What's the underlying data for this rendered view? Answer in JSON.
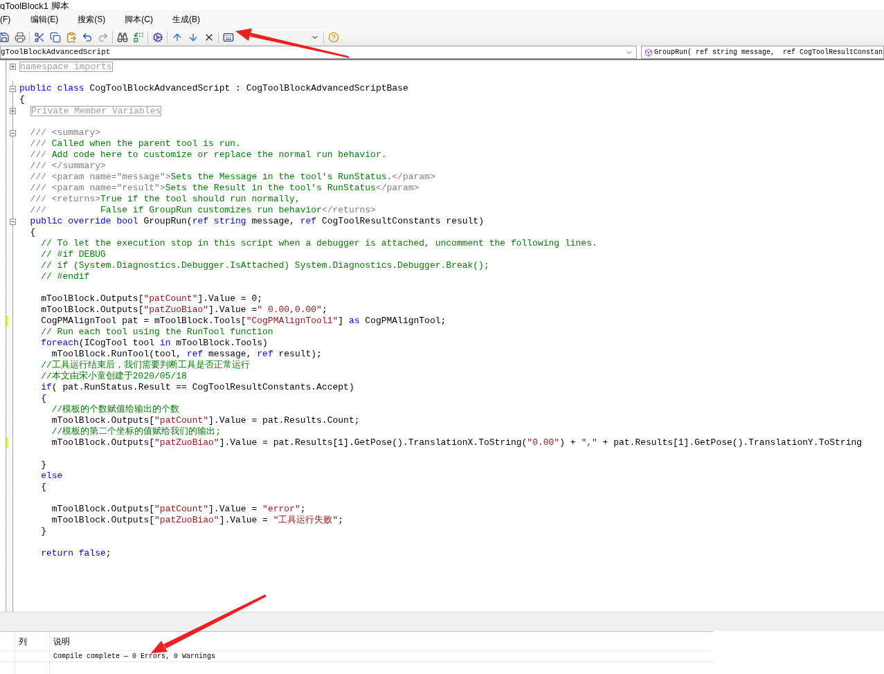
{
  "window": {
    "title": "gToolBlock1 脚本"
  },
  "menu": [
    {
      "label": "(F)"
    },
    {
      "label": "编辑(E)"
    },
    {
      "label": "搜索(S)"
    },
    {
      "label": "脚本(C)"
    },
    {
      "label": "生成(B)"
    }
  ],
  "class_selector": {
    "value": "gToolBlockAdvancedScript"
  },
  "member_selector": {
    "value": "GroupRun( ref string message,  ref CogToolResultConstan"
  },
  "editor": {
    "lines": [
      {
        "kind": "region",
        "changed": false,
        "collapsed": true,
        "text": "namespace imports"
      },
      {
        "kind": "blank",
        "changed": false
      },
      {
        "kind": "code",
        "changed": false,
        "collapsed": false,
        "tokens": [
          {
            "kind": "kw",
            "text": "public class "
          },
          {
            "kind": "plain",
            "text": "CogToolBlockAdvancedScript : CogToolBlockAdvancedScriptBase"
          }
        ]
      },
      {
        "kind": "code",
        "changed": false,
        "tokens": [
          {
            "kind": "plain",
            "text": "{"
          }
        ]
      },
      {
        "kind": "subregion",
        "changed": false,
        "collapsed": true,
        "text": "Private Member Variables"
      },
      {
        "kind": "blank",
        "changed": false
      },
      {
        "kind": "code",
        "changed": false,
        "collapsed": false,
        "tokens": [
          {
            "kind": "doc",
            "text": "  /// <summary>"
          }
        ]
      },
      {
        "kind": "code",
        "changed": false,
        "tokens": [
          {
            "kind": "doc",
            "text": "  /// "
          },
          {
            "kind": "comment",
            "text": "Called when the parent tool is run."
          }
        ]
      },
      {
        "kind": "code",
        "changed": false,
        "tokens": [
          {
            "kind": "doc",
            "text": "  /// "
          },
          {
            "kind": "comment",
            "text": "Add code here to customize or replace the normal run behavior."
          }
        ]
      },
      {
        "kind": "code",
        "changed": false,
        "tokens": [
          {
            "kind": "doc",
            "text": "  /// </summary>"
          }
        ]
      },
      {
        "kind": "code",
        "changed": false,
        "tokens": [
          {
            "kind": "doc",
            "text": "  /// <param name=\"message\">"
          },
          {
            "kind": "comment",
            "text": "Sets the Message in the tool's RunStatus."
          },
          {
            "kind": "doc",
            "text": "</param>"
          }
        ]
      },
      {
        "kind": "code",
        "changed": false,
        "tokens": [
          {
            "kind": "doc",
            "text": "  /// <param name=\"result\">"
          },
          {
            "kind": "comment",
            "text": "Sets the Result in the tool's RunStatus"
          },
          {
            "kind": "doc",
            "text": "</param>"
          }
        ]
      },
      {
        "kind": "code",
        "changed": false,
        "tokens": [
          {
            "kind": "doc",
            "text": "  /// <returns>"
          },
          {
            "kind": "comment",
            "text": "True if the tool should run normally,"
          }
        ]
      },
      {
        "kind": "code",
        "changed": false,
        "tokens": [
          {
            "kind": "doc",
            "text": "  ///          "
          },
          {
            "kind": "comment",
            "text": "False if GroupRun customizes run behavior"
          },
          {
            "kind": "doc",
            "text": "</returns>"
          }
        ]
      },
      {
        "kind": "code",
        "changed": false,
        "collapsed": false,
        "tokens": [
          {
            "kind": "kw",
            "text": "  public override bool "
          },
          {
            "kind": "plain",
            "text": "GroupRun("
          },
          {
            "kind": "kw",
            "text": "ref string "
          },
          {
            "kind": "plain",
            "text": "message, "
          },
          {
            "kind": "kw",
            "text": "ref "
          },
          {
            "kind": "plain",
            "text": "CogToolResultConstants result)"
          }
        ]
      },
      {
        "kind": "code",
        "changed": false,
        "tokens": [
          {
            "kind": "plain",
            "text": "  {"
          }
        ]
      },
      {
        "kind": "code",
        "changed": false,
        "tokens": [
          {
            "kind": "comment",
            "text": "    // To let the execution stop in this script when a debugger is attached, uncomment the following lines."
          }
        ]
      },
      {
        "kind": "code",
        "changed": false,
        "tokens": [
          {
            "kind": "comment",
            "text": "    // #if DEBUG"
          }
        ]
      },
      {
        "kind": "code",
        "changed": false,
        "tokens": [
          {
            "kind": "comment",
            "text": "    // if (System.Diagnostics.Debugger.IsAttached) System.Diagnostics.Debugger.Break();"
          }
        ]
      },
      {
        "kind": "code",
        "changed": false,
        "tokens": [
          {
            "kind": "comment",
            "text": "    // #endif"
          }
        ]
      },
      {
        "kind": "blank",
        "changed": false
      },
      {
        "kind": "code",
        "changed": false,
        "tokens": [
          {
            "kind": "plain",
            "text": "    mToolBlock.Outputs["
          },
          {
            "kind": "str",
            "text": "\"patCount\""
          },
          {
            "kind": "plain",
            "text": "].Value = 0;"
          }
        ]
      },
      {
        "kind": "code",
        "changed": false,
        "tokens": [
          {
            "kind": "plain",
            "text": "    mToolBlock.Outputs["
          },
          {
            "kind": "str",
            "text": "\"patZuoBiao\""
          },
          {
            "kind": "plain",
            "text": "].Value ="
          },
          {
            "kind": "str",
            "text": "\" 0.00,0.00\""
          },
          {
            "kind": "plain",
            "text": ";"
          }
        ]
      },
      {
        "kind": "code",
        "changed": true,
        "tokens": [
          {
            "kind": "plain",
            "text": "    CogPMAlignTool pat = mToolBlock.Tools["
          },
          {
            "kind": "str",
            "text": "\"CogPMAlignTool1\""
          },
          {
            "kind": "plain",
            "text": "] "
          },
          {
            "kind": "kw",
            "text": "as "
          },
          {
            "kind": "plain",
            "text": "CogPMAlignTool;"
          }
        ]
      },
      {
        "kind": "code",
        "changed": false,
        "tokens": [
          {
            "kind": "comment",
            "text": "    // Run each tool using the RunTool function"
          }
        ]
      },
      {
        "kind": "code",
        "changed": false,
        "tokens": [
          {
            "kind": "kw",
            "text": "    foreach"
          },
          {
            "kind": "plain",
            "text": "(ICogTool tool "
          },
          {
            "kind": "kw",
            "text": "in "
          },
          {
            "kind": "plain",
            "text": "mToolBlock.Tools)"
          }
        ]
      },
      {
        "kind": "code",
        "changed": false,
        "tokens": [
          {
            "kind": "plain",
            "text": "      mToolBlock.RunTool(tool, "
          },
          {
            "kind": "kw",
            "text": "ref "
          },
          {
            "kind": "plain",
            "text": "message, "
          },
          {
            "kind": "kw",
            "text": "ref "
          },
          {
            "kind": "plain",
            "text": "result);"
          }
        ]
      },
      {
        "kind": "code",
        "changed": false,
        "tokens": [
          {
            "kind": "comment",
            "text": "    //工具运行结束后，我们需要判断工具是否正常运行"
          }
        ]
      },
      {
        "kind": "code",
        "changed": false,
        "tokens": [
          {
            "kind": "comment",
            "text": "    //本文由宋小童创建于2020/05/18"
          }
        ]
      },
      {
        "kind": "code",
        "changed": false,
        "tokens": [
          {
            "kind": "kw",
            "text": "    if"
          },
          {
            "kind": "plain",
            "text": "( pat.RunStatus.Result == CogToolResultConstants.Accept)"
          }
        ]
      },
      {
        "kind": "code",
        "changed": false,
        "tokens": [
          {
            "kind": "plain",
            "text": "    {"
          }
        ]
      },
      {
        "kind": "code",
        "changed": false,
        "tokens": [
          {
            "kind": "comment",
            "text": "      //模板的个数赋值给输出的个数"
          }
        ]
      },
      {
        "kind": "code",
        "changed": false,
        "tokens": [
          {
            "kind": "plain",
            "text": "      mToolBlock.Outputs["
          },
          {
            "kind": "str",
            "text": "\"patCount\""
          },
          {
            "kind": "plain",
            "text": "].Value = pat.Results.Count;"
          }
        ]
      },
      {
        "kind": "code",
        "changed": false,
        "tokens": [
          {
            "kind": "comment",
            "text": "      //模板的第二个坐标的值赋给我们的输出;"
          }
        ]
      },
      {
        "kind": "code",
        "changed": true,
        "tokens": [
          {
            "kind": "plain",
            "text": "      mToolBlock.Outputs["
          },
          {
            "kind": "str",
            "text": "\"patZuoBiao\""
          },
          {
            "kind": "plain",
            "text": "].Value = pat.Results[1].GetPose().TranslationX.ToString("
          },
          {
            "kind": "str",
            "text": "\"0.00\""
          },
          {
            "kind": "plain",
            "text": ") + "
          },
          {
            "kind": "str",
            "text": "\",\""
          },
          {
            "kind": "plain",
            "text": " + pat.Results[1].GetPose().TranslationY.ToString"
          }
        ]
      },
      {
        "kind": "blank",
        "changed": false
      },
      {
        "kind": "code",
        "changed": false,
        "tokens": [
          {
            "kind": "plain",
            "text": "    }"
          }
        ]
      },
      {
        "kind": "code",
        "changed": false,
        "tokens": [
          {
            "kind": "kw",
            "text": "    else"
          }
        ]
      },
      {
        "kind": "code",
        "changed": false,
        "tokens": [
          {
            "kind": "plain",
            "text": "    {"
          }
        ]
      },
      {
        "kind": "blank",
        "changed": false
      },
      {
        "kind": "code",
        "changed": false,
        "tokens": [
          {
            "kind": "plain",
            "text": "      mToolBlock.Outputs["
          },
          {
            "kind": "str",
            "text": "\"patCount\""
          },
          {
            "kind": "plain",
            "text": "].Value = "
          },
          {
            "kind": "str",
            "text": "\"error\""
          },
          {
            "kind": "plain",
            "text": ";"
          }
        ]
      },
      {
        "kind": "code",
        "changed": false,
        "tokens": [
          {
            "kind": "plain",
            "text": "      mToolBlock.Outputs["
          },
          {
            "kind": "str",
            "text": "\"patZuoBiao\""
          },
          {
            "kind": "plain",
            "text": "].Value = "
          },
          {
            "kind": "str",
            "text": "\"工具运行失败\""
          },
          {
            "kind": "plain",
            "text": ";"
          }
        ]
      },
      {
        "kind": "code",
        "changed": false,
        "tokens": [
          {
            "kind": "plain",
            "text": "    }"
          }
        ]
      },
      {
        "kind": "blank",
        "changed": false
      },
      {
        "kind": "code",
        "changed": false,
        "tokens": [
          {
            "kind": "kw",
            "text": "    return false"
          },
          {
            "kind": "plain",
            "text": ";"
          }
        ]
      }
    ]
  },
  "error_list": {
    "columns": [
      {
        "label": "列"
      },
      {
        "label": "说明"
      }
    ],
    "rows": [
      {
        "description": "Compile complete — 0 Errors, 0 Warnings"
      }
    ]
  }
}
